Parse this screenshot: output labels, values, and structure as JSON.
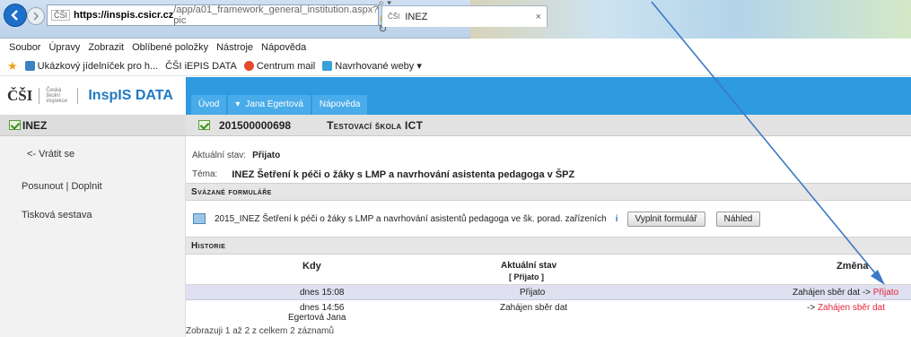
{
  "browser": {
    "url_host": "https://inspis.csicr.cz",
    "url_path": "/app/a01_framework_general_institution.aspx?pic",
    "url_prefix": "ČŠI",
    "tab_title": "INEZ",
    "tab_prefix": "ČŠI",
    "menu": [
      "Soubor",
      "Úpravy",
      "Zobrazit",
      "Oblíbené položky",
      "Nástroje",
      "Nápověda"
    ],
    "favorites": [
      "Ukázkový jídelníček pro h...",
      "ČŠI iEPIS DATA",
      "Centrum mail",
      "Navrhované weby ▾"
    ]
  },
  "app": {
    "logo_csi": "ČŠI",
    "logo_small": "Česká školní inspekce",
    "logo_name": "InspIS DATA",
    "nav": [
      {
        "label": "Úvod"
      },
      {
        "label": "Jana Egertová"
      },
      {
        "label": "Nápověda"
      }
    ]
  },
  "sidebar": {
    "title": "INEZ",
    "links": [
      "<- Vrátit se",
      "Posunout | Doplnit",
      "Tisková sestava"
    ]
  },
  "main": {
    "record_number": "201500000698",
    "school_name": "Testovací škola ICT",
    "status_label": "Aktuální stav:",
    "status_value": "Přijato",
    "topic_label": "Téma:",
    "topic_value": "INEZ Šetření k péči o žáky s LMP a navrhování asistenta pedagoga v ŠPZ",
    "linked_forms_title": "Svázané formuláře",
    "form": {
      "name": "2015_INEZ Šetření k péči o žáky s LMP a navrhování asistentů pedagoga ve šk. porad. zařízeních",
      "info": "i",
      "fill_button": "Vyplnit formulář",
      "preview_button": "Náhled"
    },
    "history_title": "Historie",
    "history": {
      "col_when": "Kdy",
      "col_status": "Aktuální stav",
      "col_status_filter": "[ Přijato ]",
      "col_change": "Změna",
      "rows": [
        {
          "when": "dnes 15:08",
          "who": "",
          "status": "Přijato",
          "change_from": "Zahájen sběr dat ->",
          "change_to": "Přijato"
        },
        {
          "when": "dnes 14:56",
          "who": "Egertová Jana",
          "status": "Zahájen sběr dat",
          "change_from": "->",
          "change_to": "Zahájen sběr dat"
        }
      ]
    },
    "footer": "Zobrazuji 1 až 2 z celkem 2 záznamů"
  },
  "colors": {
    "accent": "#2e9ae0",
    "link": "#1f79c3",
    "highlight_row": "#dfe0f0",
    "status_red": "#e8243a",
    "annotation_arrow": "#3b78c7"
  }
}
